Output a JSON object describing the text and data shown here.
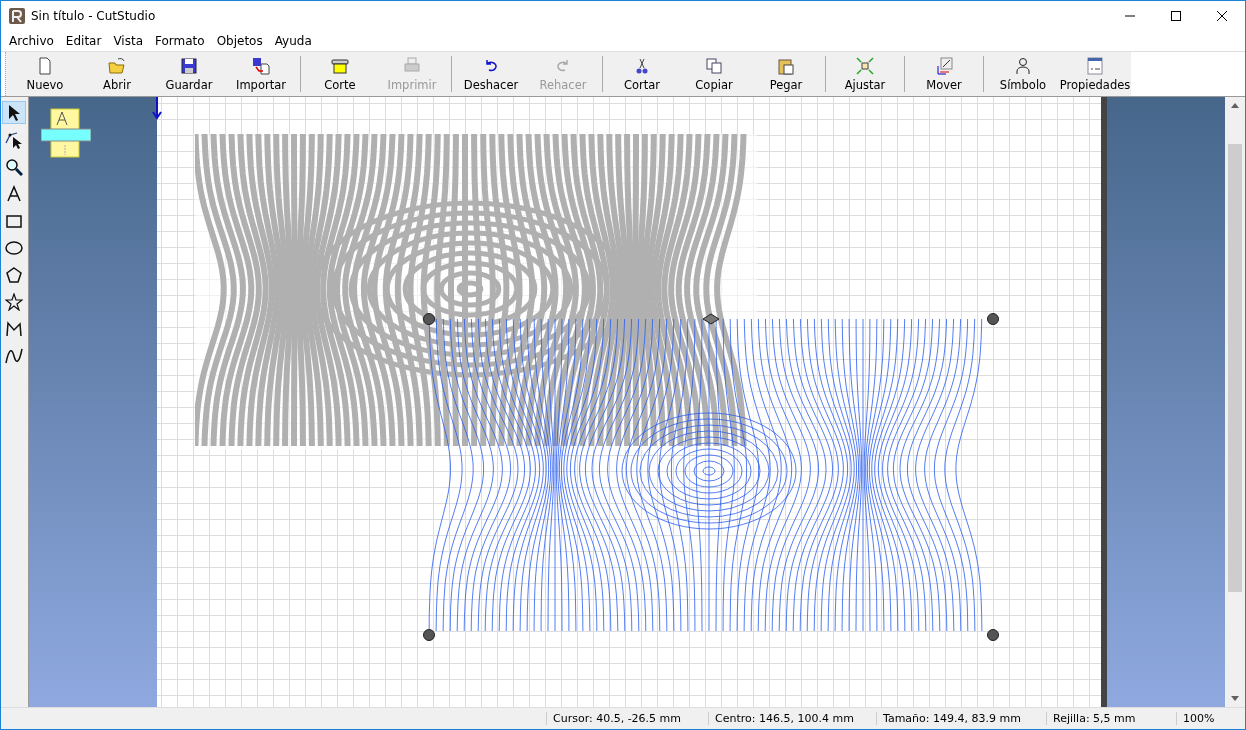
{
  "window": {
    "title": "Sin título - CutStudio"
  },
  "menu": [
    "Archivo",
    "Editar",
    "Vista",
    "Formato",
    "Objetos",
    "Ayuda"
  ],
  "toolbar": [
    [
      {
        "label": "Nuevo",
        "disabled": false
      },
      {
        "label": "Abrir",
        "disabled": false
      },
      {
        "label": "Guardar",
        "disabled": false
      },
      {
        "label": "Importar",
        "disabled": false
      }
    ],
    [
      {
        "label": "Corte",
        "disabled": false
      },
      {
        "label": "Imprimir",
        "disabled": true
      }
    ],
    [
      {
        "label": "Deshacer",
        "disabled": false
      },
      {
        "label": "Rehacer",
        "disabled": true
      }
    ],
    [
      {
        "label": "Cortar",
        "disabled": false
      },
      {
        "label": "Copiar",
        "disabled": false
      },
      {
        "label": "Pegar",
        "disabled": false
      }
    ],
    [
      {
        "label": "Ajustar",
        "disabled": false
      }
    ],
    [
      {
        "label": "Mover",
        "disabled": false
      }
    ],
    [
      {
        "label": "Símbolo",
        "disabled": false
      },
      {
        "label": "Propiedades",
        "disabled": false
      }
    ]
  ],
  "tools": [
    {
      "selected": true
    },
    {
      "selected": false
    },
    {
      "selected": false
    },
    {
      "selected": false
    },
    {
      "selected": false
    },
    {
      "selected": false
    },
    {
      "selected": false
    },
    {
      "selected": false
    },
    {
      "selected": false
    },
    {
      "selected": false
    }
  ],
  "status_bar": {
    "cursor": "Cursor: 40.5, -26.5 mm",
    "centro": "Centro: 146.5, 100.4 mm",
    "tamano": "Tamaño: 149.4, 83.9 mm",
    "rejilla": "Rejilla: 5,5 mm",
    "zoom": "100%"
  }
}
